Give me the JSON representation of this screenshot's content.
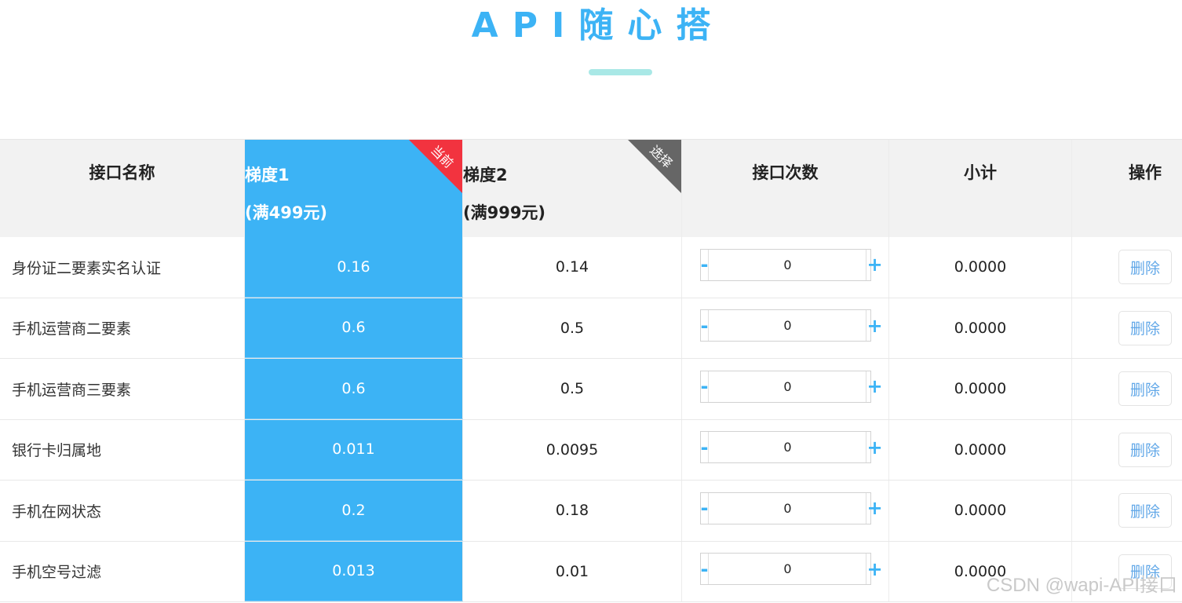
{
  "page": {
    "title": "API随心搭"
  },
  "table": {
    "headers": {
      "name": "接口名称",
      "tier1_line1": "梯度1",
      "tier1_line2": "(满499元)",
      "tier1_badge": "当前",
      "tier2_line1": "梯度2",
      "tier2_line2": "(满999元)",
      "tier2_badge": "选择",
      "qty": "接口次数",
      "subtotal": "小计",
      "op": "操作"
    },
    "rows": [
      {
        "name": "身份证二要素实名认证",
        "tier1": "0.16",
        "tier2": "0.14",
        "qty": "0",
        "subtotal": "0.0000"
      },
      {
        "name": "手机运营商二要素",
        "tier1": "0.6",
        "tier2": "0.5",
        "qty": "0",
        "subtotal": "0.0000"
      },
      {
        "name": "手机运营商三要素",
        "tier1": "0.6",
        "tier2": "0.5",
        "qty": "0",
        "subtotal": "0.0000"
      },
      {
        "name": "银行卡归属地",
        "tier1": "0.011",
        "tier2": "0.0095",
        "qty": "0",
        "subtotal": "0.0000"
      },
      {
        "name": "手机在网状态",
        "tier1": "0.2",
        "tier2": "0.18",
        "qty": "0",
        "subtotal": "0.0000"
      },
      {
        "name": "手机空号过滤",
        "tier1": "0.013",
        "tier2": "0.01",
        "qty": "0",
        "subtotal": "0.0000"
      }
    ],
    "minus_label": "-",
    "plus_label": "+",
    "delete_label": "删除"
  },
  "watermark": "CSDN @wapi-API接口",
  "colors": {
    "accent": "#3cb3f5",
    "title_bar": "#a9e8e6",
    "badge_current": "#f2333f",
    "badge_select": "#666666",
    "header_bg": "#f2f2f2",
    "delete_text": "#62a8e8"
  },
  "icons": {
    "minus": "minus-icon",
    "plus": "plus-icon"
  }
}
